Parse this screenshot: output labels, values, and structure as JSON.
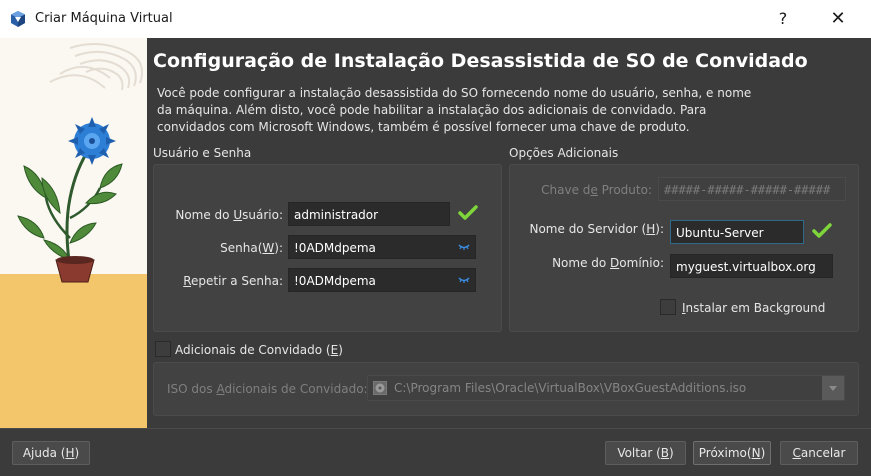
{
  "window": {
    "title": "Criar Máquina Virtual",
    "help_glyph": "?",
    "close_glyph": "✕",
    "icon": "virtualbox-icon"
  },
  "page": {
    "heading": "Configuração de Instalação Desassistida de SO de Convidado",
    "description": "Você pode configurar a instalação desassistida do SO fornecendo nome do usuário, senha, e nome da máquina. Além disto, você pode habilitar a instalação dos adicionais de convidado. Para convidados com Microsoft Windows, também é possível fornecer uma chave de produto."
  },
  "user_section": {
    "title": "Usuário e Senha",
    "username": {
      "label_pre": "Nome do ",
      "label_key": "U",
      "label_post": "suário:",
      "value": "administrador"
    },
    "password": {
      "label_pre": "Senha(",
      "label_key": "W",
      "label_post": "):",
      "value": "!0ADMdpema"
    },
    "repeat": {
      "label_pre": "",
      "label_key": "R",
      "label_post": "epetir a Senha:",
      "value": "!0ADMdpema"
    }
  },
  "options_section": {
    "title": "Opções Adicionais",
    "product_key": {
      "label_pre": "Chave d",
      "label_key": "e",
      "label_post": " Produto:",
      "value": "#####-#####-#####-#####"
    },
    "hostname": {
      "label_pre": "Nome do Servidor (",
      "label_key": "H",
      "label_post": "):",
      "value": "Ubuntu-Server"
    },
    "domain": {
      "label_pre": "Nome do ",
      "label_key": "D",
      "label_post": "omínio:",
      "value": "myguest.virtualbox.org"
    },
    "background": {
      "label_pre": "",
      "label_key": "I",
      "label_post": "nstalar em Background",
      "checked": false
    }
  },
  "guest_additions": {
    "checkbox": {
      "label_pre": "Adicionais de Convidado (",
      "label_key": "E",
      "label_post": ")",
      "checked": false
    },
    "iso": {
      "label_pre": "ISO dos ",
      "label_key": "A",
      "label_post": "dicionais de Convidado:",
      "value": "C:\\Program Files\\Oracle\\VirtualBox\\VBoxGuestAdditions.iso"
    }
  },
  "buttons": {
    "help": {
      "label_pre": "Ajuda (",
      "label_key": "H",
      "label_post": ")"
    },
    "back": {
      "label_pre": "Voltar (",
      "label_key": "B",
      "label_post": ")"
    },
    "next": {
      "label_pre": "Próximo(",
      "label_key": "N",
      "label_post": ")"
    },
    "cancel": {
      "label_pre": "",
      "label_key": "C",
      "label_post": "ancelar"
    }
  },
  "colors": {
    "background": "#3b3b3b",
    "panel": "#424242",
    "input": "#2b2b2b",
    "valid_check": "#7fd63a",
    "eye_icon": "#3a8ee6"
  }
}
